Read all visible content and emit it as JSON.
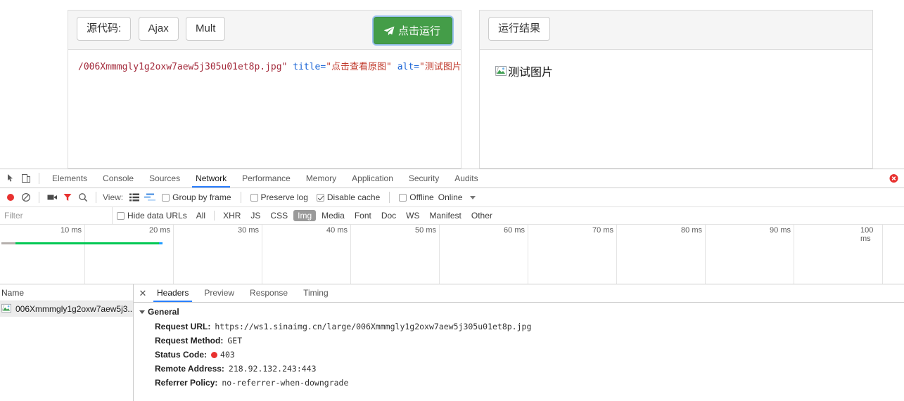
{
  "page": {
    "left_panel": {
      "buttons": [
        {
          "label": "源代码:",
          "name": "source-code-button"
        },
        {
          "label": "Ajax",
          "name": "ajax-button"
        },
        {
          "label": "Mult",
          "name": "mult-button"
        }
      ],
      "run_button_label": "点击运行",
      "run_button_color": "#449d48",
      "code": {
        "path": "/006Xmmmgly1g2oxw7aew5j305u01et8p.jpg\"",
        "attr1": "title=",
        "val1": "\"点击查看原图\"",
        "attr2": "alt=",
        "val2": "\"测试图片\""
      }
    },
    "right_panel": {
      "tab_label": "运行结果",
      "broken_image_alt": "测试图片"
    }
  },
  "devtools": {
    "tabs": [
      {
        "label": "Elements",
        "active": false
      },
      {
        "label": "Console",
        "active": false
      },
      {
        "label": "Sources",
        "active": false
      },
      {
        "label": "Network",
        "active": true
      },
      {
        "label": "Performance",
        "active": false
      },
      {
        "label": "Memory",
        "active": false
      },
      {
        "label": "Application",
        "active": false
      },
      {
        "label": "Security",
        "active": false
      },
      {
        "label": "Audits",
        "active": false
      }
    ],
    "toolbar": {
      "view_label": "View:",
      "group_by_frame": {
        "label": "Group by frame",
        "checked": false
      },
      "preserve_log": {
        "label": "Preserve log",
        "checked": false
      },
      "disable_cache": {
        "label": "Disable cache",
        "checked": true
      },
      "offline": {
        "label": "Offline",
        "checked": false
      },
      "throttling": "Online"
    },
    "filterbar": {
      "filter_placeholder": "Filter",
      "filter_value": "",
      "hide_data_urls": {
        "label": "Hide data URLs",
        "checked": false
      },
      "types": [
        {
          "label": "All",
          "selected": false
        },
        {
          "label": "XHR",
          "selected": false
        },
        {
          "label": "JS",
          "selected": false
        },
        {
          "label": "CSS",
          "selected": false
        },
        {
          "label": "Img",
          "selected": true
        },
        {
          "label": "Media",
          "selected": false
        },
        {
          "label": "Font",
          "selected": false
        },
        {
          "label": "Doc",
          "selected": false
        },
        {
          "label": "WS",
          "selected": false
        },
        {
          "label": "Manifest",
          "selected": false
        },
        {
          "label": "Other",
          "selected": false
        }
      ]
    },
    "overview": {
      "ticks": [
        "10 ms",
        "20 ms",
        "30 ms",
        "40 ms",
        "50 ms",
        "60 ms",
        "70 ms",
        "80 ms",
        "90 ms",
        "100 ms"
      ],
      "request_bar": {
        "stalled_color": "#b5b0ad",
        "download_color": "#00c853",
        "waiting_color": "#1e9bff"
      }
    },
    "requests": {
      "column_header": "Name",
      "rows": [
        {
          "name": "006Xmmmgly1g2oxw7aew5j3...",
          "selected": true
        }
      ]
    },
    "detail": {
      "tabs": [
        {
          "label": "Headers",
          "active": true
        },
        {
          "label": "Preview",
          "active": false
        },
        {
          "label": "Response",
          "active": false
        },
        {
          "label": "Timing",
          "active": false
        }
      ],
      "section_title": "General",
      "headers": [
        {
          "key": "Request URL:",
          "value": "https://ws1.sinaimg.cn/large/006Xmmmgly1g2oxw7aew5j305u01et8p.jpg",
          "status": false
        },
        {
          "key": "Request Method:",
          "value": "GET",
          "status": false
        },
        {
          "key": "Status Code:",
          "value": "403",
          "status": true
        },
        {
          "key": "Remote Address:",
          "value": "218.92.132.243:443",
          "status": false
        },
        {
          "key": "Referrer Policy:",
          "value": "no-referrer-when-downgrade",
          "status": false
        }
      ],
      "status_color": "#e8312f"
    }
  }
}
